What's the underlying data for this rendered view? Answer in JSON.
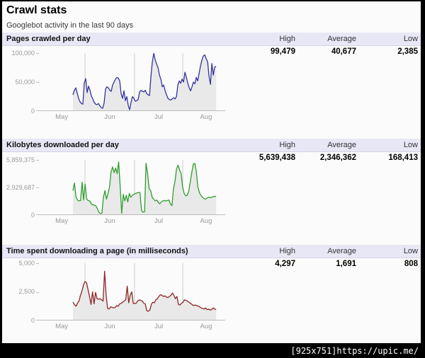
{
  "page": {
    "title": "Crawl stats",
    "subtitle": "Googlebot activity in the last 90 days"
  },
  "columns": {
    "high": "High",
    "average": "Average",
    "low": "Low"
  },
  "months": [
    "May",
    "Jun",
    "Jul",
    "Aug"
  ],
  "watermark": "[925x751]https://upic.me/",
  "colors": {
    "pages_line": "#3333a0",
    "kilobytes_line": "#2e9e2e",
    "time_line": "#8e2626",
    "fill": "#e9e9e9",
    "grid": "#cccccc",
    "axis": "#bdbdbd",
    "section_bar_bg": "#e7e7f6"
  },
  "chart_data": [
    {
      "type": "line",
      "title": "Pages crawled per day",
      "high": "99,479",
      "average": "40,677",
      "low": "2,385",
      "high_value": 99479,
      "average_value": 40677,
      "low_value": 2385,
      "line_color": "#3333a0",
      "ylim": [
        0,
        100000
      ],
      "yticks": [
        "100,000",
        "50,000",
        "0"
      ],
      "x_labels": [
        "May",
        "Jun",
        "Jul",
        "Aug"
      ],
      "x_span": "last 90 days (late May - late Aug)",
      "values": [
        28000,
        36000,
        40000,
        31000,
        22000,
        16000,
        13000,
        12000,
        48000,
        56000,
        32000,
        43000,
        36000,
        26000,
        21000,
        15000,
        12000,
        11000,
        13000,
        9000,
        6000,
        5000,
        14000,
        38000,
        42000,
        40000,
        36000,
        34000,
        45000,
        50000,
        55000,
        58000,
        57000,
        52000,
        30000,
        22000,
        35000,
        18000,
        25000,
        10000,
        2385,
        15000,
        25000,
        22000,
        17000,
        18000,
        20000,
        33000,
        36000,
        34000,
        33000,
        36000,
        30000,
        28000,
        27000,
        60000,
        85000,
        99479,
        88000,
        81000,
        75000,
        62000,
        55000,
        42000,
        45000,
        35000,
        28000,
        22000,
        20000,
        19000,
        21000,
        23000,
        21000,
        25000,
        45000,
        52000,
        48000,
        55000,
        50000,
        67000,
        58000,
        48000,
        40000,
        35000,
        42000,
        50000,
        47000,
        58000,
        52000,
        65000,
        78000,
        88000,
        95000,
        97000,
        90000,
        85000,
        60000,
        46000,
        82000,
        62000,
        76000,
        77000
      ]
    },
    {
      "type": "line",
      "title": "Kilobytes downloaded per day",
      "high": "5,639,438",
      "average": "2,346,362",
      "low": "168,413",
      "high_value": 5639438,
      "average_value": 2346362,
      "low_value": 168413,
      "line_color": "#2e9e2e",
      "ylim": [
        0,
        5859375
      ],
      "yticks": [
        "5,859,375",
        "2,929,687",
        "0"
      ],
      "x_labels": [
        "May",
        "Jun",
        "Jul",
        "Aug"
      ],
      "x_span": "last 90 days (late May - late Aug)",
      "values": [
        2600000,
        3400000,
        1900000,
        1600000,
        1500000,
        1550000,
        3500000,
        1600000,
        3300000,
        1700000,
        1550000,
        1500000,
        1200000,
        1100000,
        1050000,
        1000000,
        700000,
        300000,
        168413,
        200000,
        1900000,
        2600000,
        1700000,
        2300000,
        3000000,
        4600000,
        5100000,
        4500000,
        5000000,
        4400000,
        5639438,
        3000000,
        200000,
        2200000,
        1500000,
        2100000,
        1400000,
        2300000,
        1900000,
        2100000,
        2200000,
        2300000,
        2350000,
        2400000,
        2400000,
        500000,
        300000,
        350000,
        5500000,
        4400000,
        2800000,
        2600000,
        1900000,
        1700000,
        1500000,
        1600000,
        1350000,
        1200000,
        1400000,
        1500000,
        1550000,
        1500000,
        1550000,
        1600000,
        1200000,
        1000000,
        2800000,
        3600000,
        4900000,
        5300000,
        4800000,
        4400000,
        3000000,
        2300000,
        2050000,
        2100000,
        2500000,
        3500000,
        4500000,
        5400000,
        5500000,
        4600000,
        3000000,
        2400000,
        2100000,
        1900000,
        1750000,
        1700000,
        1800000,
        1900000,
        1850000,
        1900000,
        1950000,
        2000000,
        1950000
      ]
    },
    {
      "type": "line",
      "title": "Time spent downloading a page (in milliseconds)",
      "high": "4,297",
      "average": "1,691",
      "low": "808",
      "high_value": 4297,
      "average_value": 1691,
      "low_value": 808,
      "line_color": "#8e2626",
      "ylim": [
        0,
        5000
      ],
      "yticks": [
        "5,000",
        "2,500",
        "0"
      ],
      "x_labels": [
        "May",
        "Jun",
        "Jul",
        "Aug"
      ],
      "x_span": "last 90 days (late May - late Aug)",
      "values": [
        1600,
        1400,
        1250,
        1500,
        1700,
        2200,
        2600,
        3100,
        3400,
        3300,
        2700,
        2100,
        1400,
        2500,
        1450,
        2450,
        1900,
        1850,
        1900,
        1800,
        1700,
        4297,
        2200,
        1050,
        1000,
        1200,
        1150,
        1100,
        1150,
        1300,
        1250,
        1450,
        1500,
        1600,
        1700,
        1800,
        3000,
        1550,
        2200,
        2500,
        1500,
        1480,
        1520,
        1700,
        1800,
        1750,
        1700,
        1500,
        1450,
        850,
        808,
        900,
        1400,
        1600,
        1550,
        1800,
        1900,
        2100,
        2250,
        2200,
        2100,
        2150,
        2050,
        2000,
        2100,
        2200,
        2400,
        2200,
        1900,
        2100,
        1400,
        1350,
        1500,
        1600,
        1800,
        1750,
        1700,
        1600,
        1500,
        1400,
        1300,
        1350,
        1300,
        1250,
        1200,
        1100,
        1050,
        1000,
        1100,
        950,
        1000,
        900,
        950,
        1100,
        1000,
        950
      ]
    }
  ]
}
